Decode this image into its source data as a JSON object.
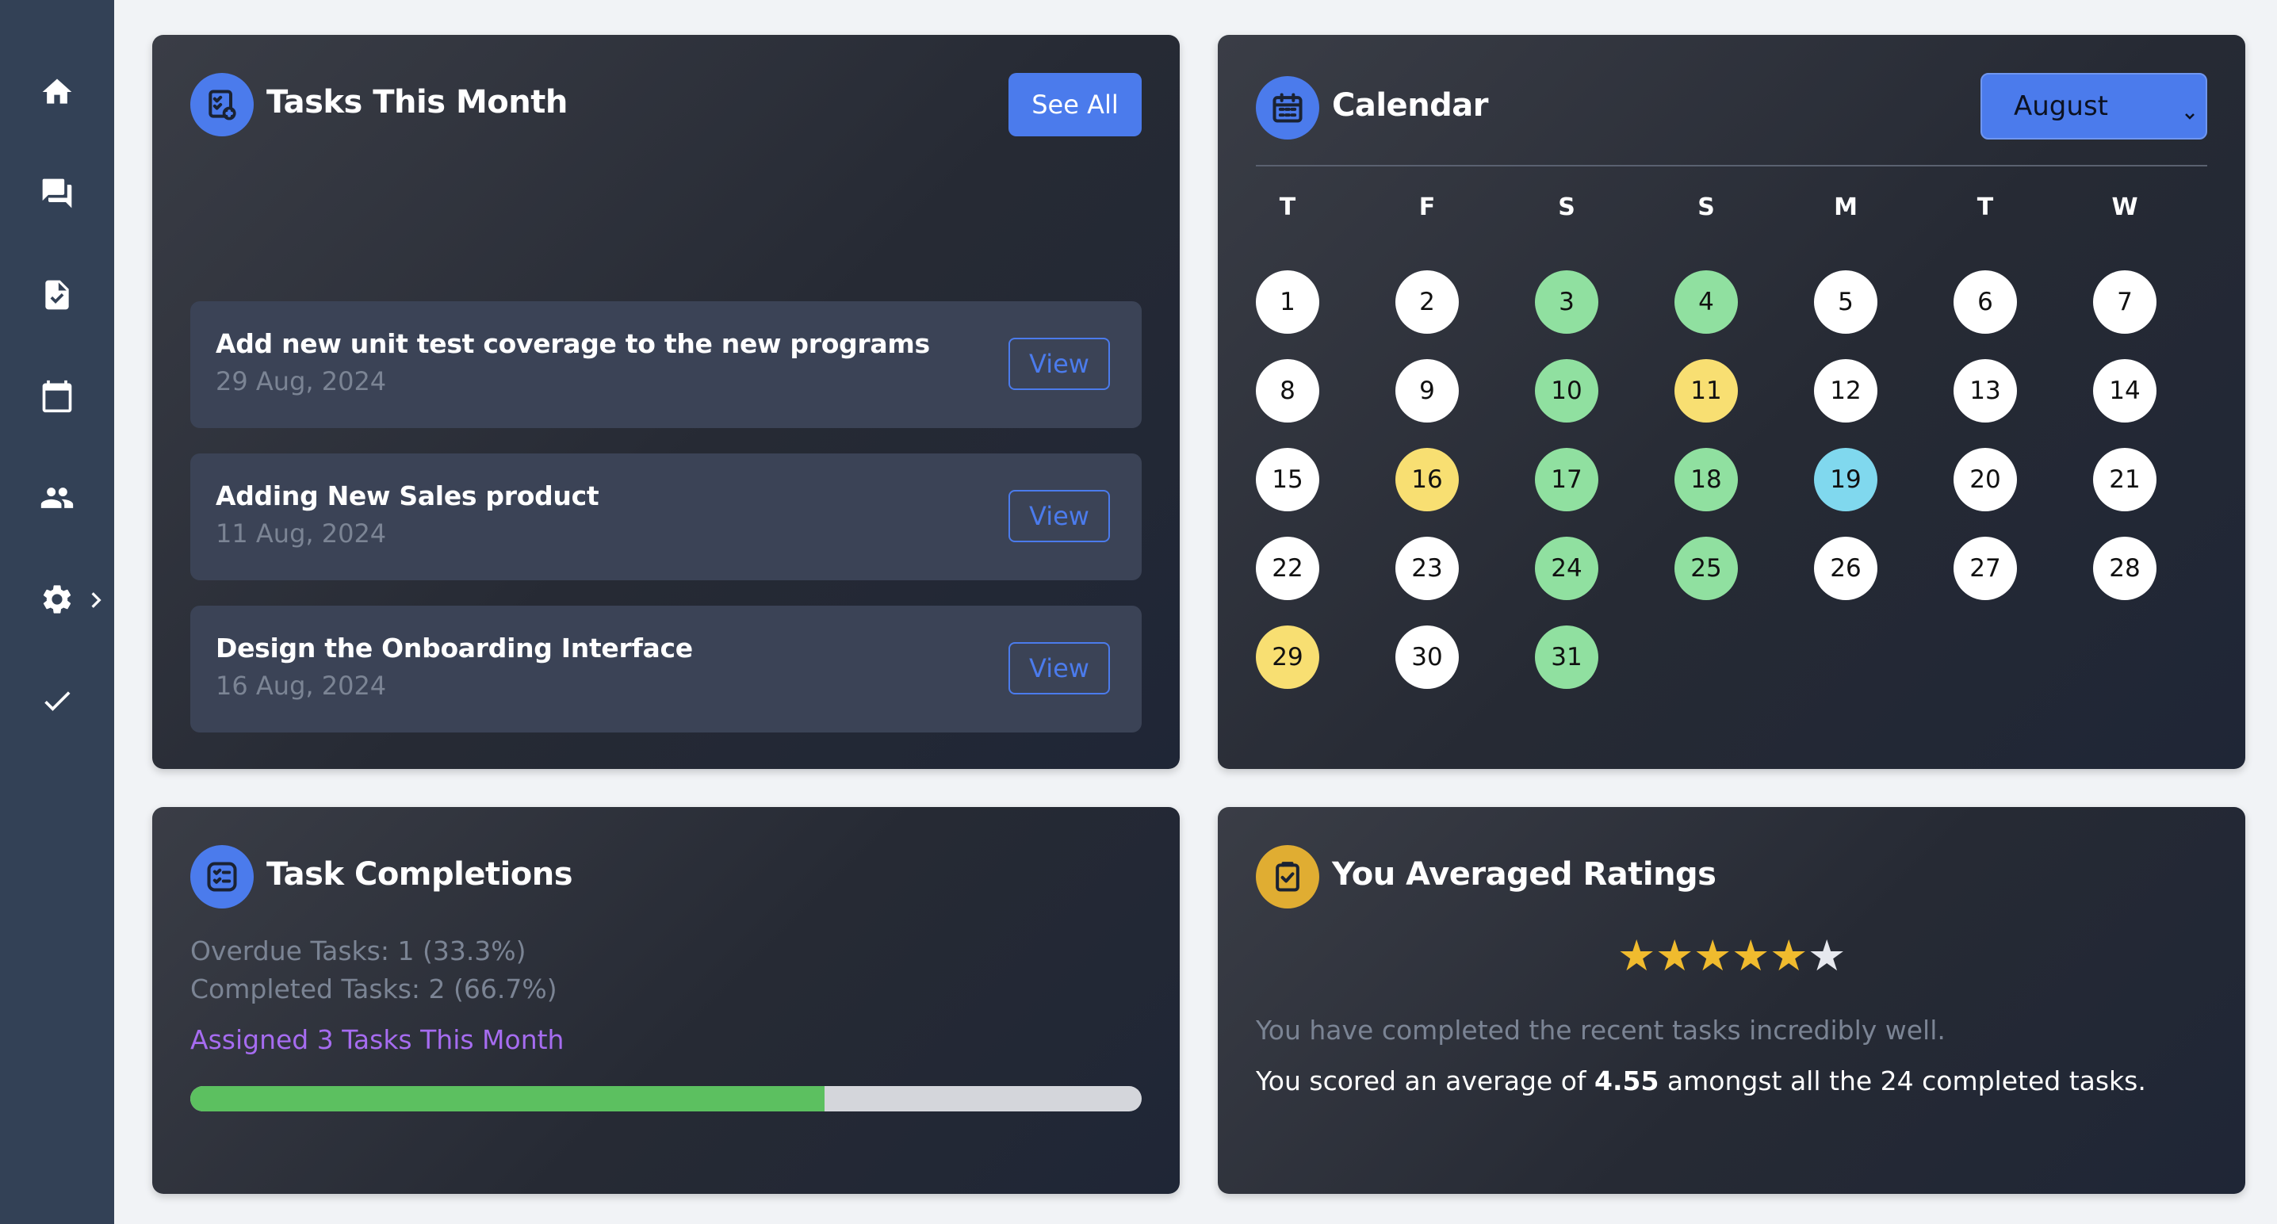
{
  "sidebar": {
    "items": [
      {
        "icon": "home-icon"
      },
      {
        "icon": "chat-icon"
      },
      {
        "icon": "task-document-icon"
      },
      {
        "icon": "calendar-icon"
      },
      {
        "icon": "people-icon"
      },
      {
        "icon": "gear-icon",
        "has_submenu": true
      },
      {
        "icon": "checkmark-icon"
      }
    ]
  },
  "tasks": {
    "title": "Tasks This Month",
    "see_all_label": "See All",
    "items": [
      {
        "name": "Add new unit test coverage to the new programs",
        "date": "29 Aug, 2024",
        "action": "View"
      },
      {
        "name": "Adding New Sales product",
        "date": "11 Aug, 2024",
        "action": "View"
      },
      {
        "name": "Design the Onboarding Interface",
        "date": "16 Aug, 2024",
        "action": "View"
      }
    ]
  },
  "calendar": {
    "title": "Calendar",
    "month": "August",
    "weekdays": [
      "T",
      "F",
      "S",
      "S",
      "M",
      "T",
      "W"
    ],
    "days": [
      {
        "d": "1",
        "s": "none"
      },
      {
        "d": "2",
        "s": "none"
      },
      {
        "d": "3",
        "s": "green"
      },
      {
        "d": "4",
        "s": "green"
      },
      {
        "d": "5",
        "s": "none"
      },
      {
        "d": "6",
        "s": "none"
      },
      {
        "d": "7",
        "s": "none"
      },
      {
        "d": "8",
        "s": "none"
      },
      {
        "d": "9",
        "s": "none"
      },
      {
        "d": "10",
        "s": "green"
      },
      {
        "d": "11",
        "s": "yellow"
      },
      {
        "d": "12",
        "s": "none"
      },
      {
        "d": "13",
        "s": "none"
      },
      {
        "d": "14",
        "s": "none"
      },
      {
        "d": "15",
        "s": "none"
      },
      {
        "d": "16",
        "s": "yellow"
      },
      {
        "d": "17",
        "s": "green"
      },
      {
        "d": "18",
        "s": "green"
      },
      {
        "d": "19",
        "s": "blue"
      },
      {
        "d": "20",
        "s": "none"
      },
      {
        "d": "21",
        "s": "none"
      },
      {
        "d": "22",
        "s": "none"
      },
      {
        "d": "23",
        "s": "none"
      },
      {
        "d": "24",
        "s": "green"
      },
      {
        "d": "25",
        "s": "green"
      },
      {
        "d": "26",
        "s": "none"
      },
      {
        "d": "27",
        "s": "none"
      },
      {
        "d": "28",
        "s": "none"
      },
      {
        "d": "29",
        "s": "yellow"
      },
      {
        "d": "30",
        "s": "none"
      },
      {
        "d": "31",
        "s": "green"
      }
    ]
  },
  "completions": {
    "title": "Task Completions",
    "overdue": "Overdue Tasks: 1 (33.3%)",
    "completed": "Completed Tasks: 2 (66.7%)",
    "assigned": "Assigned 3 Tasks This Month",
    "progress_fraction": 0.667
  },
  "ratings": {
    "title": "You Averaged Ratings",
    "stars_filled": 5,
    "stars_total": 6,
    "message": "You have completed the recent tasks incredibly well.",
    "score_prefix": "You scored an average of ",
    "score_value": "4.55",
    "score_suffix": " amongst all the 24 completed tasks."
  },
  "colors": {
    "accent": "#4b7bec",
    "sidebar": "#334156",
    "day_green": "#90e0a0",
    "day_yellow": "#f8df72",
    "day_blue": "#80d8ee",
    "progress": "#5cc060",
    "assigned_text": "#a66cf0",
    "star": "#f0bb2e"
  }
}
